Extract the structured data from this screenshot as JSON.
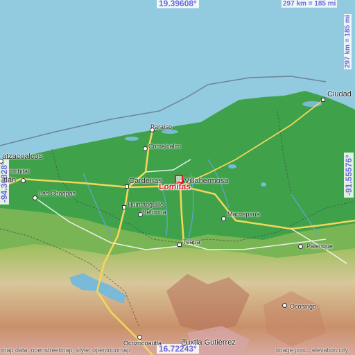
{
  "map": {
    "place": "Lomitas",
    "coords": {
      "top_lat": "19.39608°",
      "bottom_lat": "16.72243°",
      "left_lon": "-94.36828°",
      "right_lon": "-91.55576°"
    },
    "scale": {
      "horizontal": "297 km = 185 mi",
      "vertical": "297 km = 185 mi"
    },
    "cities": [
      "Coatzacoalcos",
      "Minatitlán",
      "Las Choapas",
      "Paraíso",
      "Comalcalco",
      "Cárdenas",
      "Villahermosa",
      "Huimanguillo",
      "Reforma",
      "Teapa",
      "Macuspana",
      "Ciudad del Carmen",
      "Palenque",
      "Ocosingo",
      "Ocozocoautla",
      "Tuxtla Gutiérrez"
    ],
    "labels": {
      "coatzacoalcos": "atzacoalcos",
      "minatitlan": "itlán",
      "las_choapas": "Las Choapas",
      "paraiso": "Paraíso",
      "comalcalco": "Comalcalco",
      "cardenas": "Cárdenas",
      "villahermosa": "Villahermosa",
      "huimanguillo": "Huimanguillo",
      "reforma": "Reforma",
      "teapa": "Teapa",
      "macuspana": "Macuspana",
      "ciudad": "Ciudad",
      "palenque": "Palenque",
      "ocosingo": "Ocosingo",
      "ocozocoautla": "Ocozocoautla",
      "tuxtla": "Tuxtla Gutiérrez",
      "minor_left": "inchital"
    },
    "attribution_left": "map data: openstreetmap, style: opentopomap",
    "attribution_right": "image proc.: elevation.city",
    "colors": {
      "sea": "#92cbe0",
      "lowland": "#3fa24a",
      "marker": "#e0202a",
      "coord_text": "#6a6ad8"
    }
  }
}
